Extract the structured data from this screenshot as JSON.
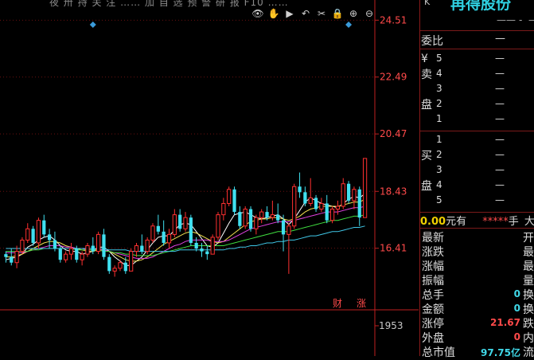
{
  "header_clip": "夜 卅 持 关 注 ……  加 自 选   预 警 研 报   F10 ……",
  "toolbar": {
    "icons": [
      "eye-icon",
      "hand-icon",
      "play-icon",
      "undo-icon",
      "scissors-icon",
      "lock-icon",
      "zoom-in-icon",
      "zoom-out-icon"
    ],
    "glyphs": [
      "👁",
      "✋",
      "▶",
      "↶",
      "✂",
      "🔒",
      "⊕",
      "⊖"
    ]
  },
  "chart_data": {
    "type": "candlestick",
    "y_axis": {
      "ticks": [
        "24.51",
        "22.49",
        "20.47",
        "18.43",
        "16.41"
      ],
      "range": [
        15.1,
        25.0
      ]
    },
    "volume_axis": {
      "label": "1953"
    },
    "candles": [
      [
        16.2,
        16.3,
        15.9,
        16.1
      ],
      [
        16.1,
        16.4,
        15.8,
        15.9
      ],
      [
        15.9,
        16.5,
        15.7,
        16.3
      ],
      [
        16.3,
        16.8,
        16.2,
        16.7
      ],
      [
        16.7,
        17.3,
        16.6,
        17.1
      ],
      [
        17.1,
        17.2,
        16.5,
        16.6
      ],
      [
        16.6,
        17.5,
        16.4,
        17.4
      ],
      [
        17.4,
        17.6,
        16.8,
        16.9
      ],
      [
        16.9,
        17.1,
        16.4,
        16.7
      ],
      [
        16.7,
        17.0,
        16.3,
        16.4
      ],
      [
        16.4,
        16.5,
        15.9,
        16.0
      ],
      [
        16.0,
        16.3,
        15.9,
        16.2
      ],
      [
        16.2,
        16.6,
        16.0,
        16.4
      ],
      [
        16.4,
        16.5,
        15.9,
        16.0
      ],
      [
        16.0,
        16.3,
        15.8,
        16.2
      ],
      [
        16.2,
        16.6,
        16.1,
        16.5
      ],
      [
        16.5,
        16.8,
        16.2,
        16.3
      ],
      [
        16.3,
        17.0,
        16.2,
        16.9
      ],
      [
        16.9,
        17.1,
        16.0,
        16.1
      ],
      [
        16.1,
        16.2,
        15.5,
        15.6
      ],
      [
        15.6,
        15.8,
        15.4,
        15.7
      ],
      [
        15.7,
        16.0,
        15.6,
        15.9
      ],
      [
        15.9,
        16.1,
        15.5,
        15.6
      ],
      [
        15.6,
        16.4,
        15.6,
        16.3
      ],
      [
        16.3,
        16.6,
        16.1,
        16.5
      ],
      [
        16.5,
        16.9,
        16.2,
        16.3
      ],
      [
        16.3,
        16.8,
        16.2,
        16.7
      ],
      [
        16.7,
        17.3,
        16.6,
        17.2
      ],
      [
        17.2,
        17.6,
        16.9,
        17.0
      ],
      [
        17.0,
        17.4,
        16.5,
        16.6
      ],
      [
        16.6,
        17.1,
        16.4,
        16.9
      ],
      [
        16.9,
        17.8,
        16.8,
        17.6
      ],
      [
        17.6,
        17.8,
        17.0,
        17.1
      ],
      [
        17.1,
        17.7,
        17.0,
        17.5
      ],
      [
        17.5,
        17.6,
        16.5,
        16.6
      ],
      [
        16.6,
        16.8,
        16.3,
        16.4
      ],
      [
        16.4,
        16.6,
        16.1,
        16.3
      ],
      [
        16.3,
        16.5,
        16.0,
        16.2
      ],
      [
        16.2,
        16.9,
        16.2,
        16.8
      ],
      [
        16.8,
        17.7,
        16.7,
        17.6
      ],
      [
        17.6,
        18.2,
        17.4,
        18.0
      ],
      [
        18.0,
        18.6,
        17.9,
        18.5
      ],
      [
        18.5,
        18.6,
        17.6,
        17.7
      ],
      [
        17.7,
        17.9,
        17.1,
        17.2
      ],
      [
        17.2,
        17.9,
        17.1,
        17.8
      ],
      [
        17.8,
        17.9,
        17.0,
        17.1
      ],
      [
        17.1,
        17.6,
        16.9,
        17.5
      ],
      [
        17.5,
        17.8,
        17.3,
        17.7
      ],
      [
        17.7,
        17.9,
        17.4,
        17.5
      ],
      [
        17.5,
        18.1,
        17.4,
        17.6
      ],
      [
        17.6,
        18.0,
        17.3,
        17.4
      ],
      [
        17.4,
        17.6,
        16.3,
        16.9
      ],
      [
        16.9,
        17.3,
        15.5,
        17.2
      ],
      [
        17.2,
        18.7,
        17.1,
        18.6
      ],
      [
        18.6,
        19.1,
        18.2,
        18.4
      ],
      [
        18.4,
        18.6,
        17.9,
        18.0
      ],
      [
        18.0,
        18.9,
        17.9,
        18.2
      ],
      [
        18.2,
        18.3,
        17.7,
        17.8
      ],
      [
        17.8,
        18.2,
        17.7,
        18.0
      ],
      [
        18.0,
        18.3,
        17.3,
        17.4
      ],
      [
        17.4,
        17.9,
        17.3,
        17.8
      ],
      [
        17.8,
        18.1,
        17.6,
        17.9
      ],
      [
        17.9,
        18.9,
        17.8,
        18.7
      ],
      [
        18.7,
        18.8,
        18.0,
        18.1
      ],
      [
        18.1,
        18.6,
        17.8,
        18.5
      ],
      [
        18.5,
        18.6,
        17.2,
        17.5
      ],
      [
        17.5,
        19.6,
        18.4,
        19.6
      ]
    ],
    "ma_lines": [
      {
        "color": "#ffffff",
        "values": [
          16.0,
          16.05,
          16.1,
          16.2,
          16.45,
          16.55,
          16.7,
          16.8,
          16.85,
          16.7,
          16.5,
          16.35,
          16.3,
          16.3,
          16.2,
          16.25,
          16.3,
          16.45,
          16.45,
          16.3,
          16.1,
          15.95,
          15.8,
          15.8,
          15.95,
          16.1,
          16.35,
          16.6,
          16.8,
          16.85,
          16.85,
          17.05,
          17.25,
          17.3,
          17.25,
          17.0,
          16.75,
          16.5,
          16.45,
          16.6,
          16.95,
          17.3,
          17.6,
          17.65,
          17.7,
          17.6,
          17.5,
          17.45,
          17.5,
          17.55,
          17.6,
          17.45,
          17.25,
          17.45,
          17.75,
          18.05,
          18.2,
          18.1,
          18.0,
          17.95,
          17.9,
          17.85,
          18.0,
          18.15,
          18.25,
          18.2,
          18.35
        ]
      },
      {
        "color": "#f0e050",
        "values": [
          16.1,
          16.1,
          16.15,
          16.2,
          16.3,
          16.4,
          16.5,
          16.6,
          16.65,
          16.65,
          16.6,
          16.5,
          16.45,
          16.4,
          16.35,
          16.3,
          16.3,
          16.35,
          16.35,
          16.3,
          16.2,
          16.1,
          16.0,
          15.95,
          15.95,
          16.0,
          16.1,
          16.25,
          16.4,
          16.55,
          16.65,
          16.75,
          16.85,
          16.95,
          17.0,
          16.95,
          16.85,
          16.75,
          16.65,
          16.6,
          16.65,
          16.8,
          16.95,
          17.1,
          17.25,
          17.35,
          17.4,
          17.45,
          17.45,
          17.5,
          17.5,
          17.45,
          17.4,
          17.45,
          17.55,
          17.7,
          17.8,
          17.85,
          17.9,
          17.9,
          17.9,
          17.9,
          17.95,
          18.0,
          18.05,
          18.05,
          18.15
        ]
      },
      {
        "color": "#e040e0",
        "values": [
          16.25,
          16.25,
          16.25,
          16.25,
          16.3,
          16.35,
          16.4,
          16.45,
          16.5,
          16.5,
          16.5,
          16.45,
          16.45,
          16.4,
          16.4,
          16.35,
          16.35,
          16.35,
          16.35,
          16.3,
          16.25,
          16.2,
          16.15,
          16.1,
          16.05,
          16.05,
          16.05,
          16.1,
          16.2,
          16.3,
          16.4,
          16.5,
          16.55,
          16.65,
          16.7,
          16.7,
          16.7,
          16.7,
          16.65,
          16.65,
          16.65,
          16.7,
          16.8,
          16.9,
          17.0,
          17.1,
          17.15,
          17.2,
          17.25,
          17.3,
          17.35,
          17.35,
          17.35,
          17.4,
          17.45,
          17.5,
          17.55,
          17.6,
          17.65,
          17.7,
          17.7,
          17.7,
          17.75,
          17.8,
          17.85,
          17.85,
          17.9
        ]
      },
      {
        "color": "#40e040",
        "values": [
          16.3,
          16.3,
          16.3,
          16.3,
          16.3,
          16.35,
          16.35,
          16.4,
          16.4,
          16.4,
          16.4,
          16.4,
          16.4,
          16.35,
          16.35,
          16.35,
          16.35,
          16.35,
          16.3,
          16.3,
          16.25,
          16.25,
          16.2,
          16.2,
          16.15,
          16.15,
          16.15,
          16.15,
          16.2,
          16.25,
          16.3,
          16.35,
          16.4,
          16.45,
          16.5,
          16.5,
          16.5,
          16.5,
          16.5,
          16.5,
          16.5,
          16.55,
          16.6,
          16.65,
          16.7,
          16.75,
          16.8,
          16.85,
          16.9,
          16.95,
          17.0,
          17.0,
          17.0,
          17.05,
          17.1,
          17.15,
          17.2,
          17.25,
          17.3,
          17.35,
          17.4,
          17.4,
          17.45,
          17.5,
          17.55,
          17.55,
          17.6
        ]
      },
      {
        "color": "#40c8e8",
        "values": [
          16.4,
          16.4,
          16.4,
          16.4,
          16.4,
          16.4,
          16.4,
          16.4,
          16.4,
          16.4,
          16.4,
          16.4,
          16.4,
          16.4,
          16.4,
          16.4,
          16.4,
          16.4,
          16.4,
          16.35,
          16.35,
          16.35,
          16.35,
          16.3,
          16.3,
          16.3,
          16.3,
          16.3,
          16.3,
          16.3,
          16.3,
          16.3,
          16.35,
          16.35,
          16.35,
          16.35,
          16.35,
          16.35,
          16.35,
          16.35,
          16.35,
          16.4,
          16.4,
          16.45,
          16.45,
          16.5,
          16.5,
          16.55,
          16.6,
          16.6,
          16.65,
          16.65,
          16.7,
          16.7,
          16.75,
          16.8,
          16.85,
          16.85,
          16.9,
          16.95,
          17.0,
          17.0,
          17.05,
          17.1,
          17.15,
          17.15,
          17.2
        ]
      }
    ],
    "markers": [
      {
        "x_index": 16,
        "color": "#3a9ad9"
      },
      {
        "x_index": 63,
        "color": "#3a9ad9"
      }
    ],
    "bottom_tags": [
      "财",
      "涨"
    ]
  },
  "quote": {
    "title": "再得股份",
    "k_label": "K",
    "sub_dashes": [
      "——",
      "-",
      "—"
    ],
    "weibi_label": "委比",
    "weibi_value": "—",
    "sell_side": [
      "卖",
      "盘"
    ],
    "sell_yen": "¥",
    "buy_side": [
      "买",
      "盘"
    ],
    "sell_levels": [
      {
        "n": "5",
        "v": "—"
      },
      {
        "n": "4",
        "v": "—"
      },
      {
        "n": "3",
        "v": "—"
      },
      {
        "n": "2",
        "v": "—"
      },
      {
        "n": "1",
        "v": "—"
      }
    ],
    "buy_levels": [
      {
        "n": "1",
        "v": "—"
      },
      {
        "n": "2",
        "v": "—"
      },
      {
        "n": "3",
        "v": "—"
      },
      {
        "n": "4",
        "v": "—"
      },
      {
        "n": "5",
        "v": "—"
      }
    ],
    "yuan_value": "0.00",
    "yuan_unit": "元有",
    "stars": "*****",
    "stars_unit": "手",
    "big_buy": "大买",
    "stats": [
      {
        "label": "最新",
        "value": "",
        "color": "#ddd",
        "right": "开"
      },
      {
        "label": "涨跌",
        "value": "",
        "color": "#ddd",
        "right": "最"
      },
      {
        "label": "涨幅",
        "value": "",
        "color": "#ddd",
        "right": "最"
      },
      {
        "label": "振幅",
        "value": "",
        "color": "#ddd",
        "right": "量"
      },
      {
        "label": "总手",
        "value": "0",
        "color": "#40d8e8",
        "right": "换"
      },
      {
        "label": "金额",
        "value": "0",
        "color": "#40d8e8",
        "right": "换"
      },
      {
        "label": "涨停",
        "value": "21.67",
        "color": "#ff4a4a",
        "right": "跌"
      },
      {
        "label": "外盘",
        "value": "0",
        "color": "#ff4a4a",
        "right": "内"
      },
      {
        "label": "总市值",
        "value": "97.75亿",
        "color": "#40d8e8",
        "right": "流"
      }
    ]
  }
}
